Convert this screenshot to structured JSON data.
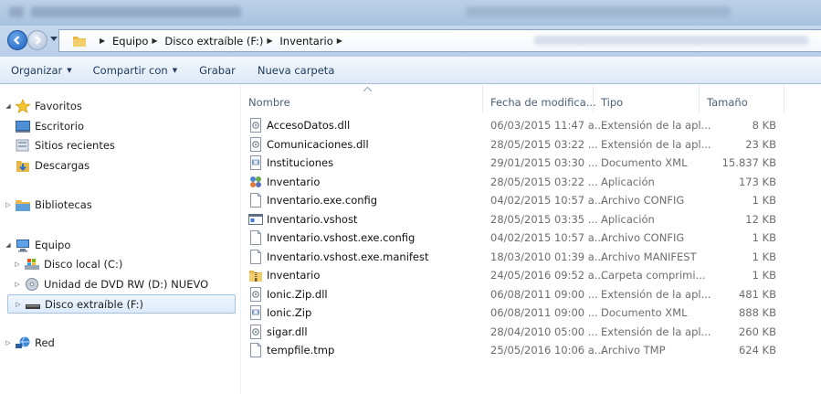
{
  "address": {
    "crumbs": [
      "Equipo",
      "Disco extraíble (F:)",
      "Inventario"
    ]
  },
  "toolbar": {
    "organize": "Organizar",
    "share": "Compartir con",
    "burn": "Grabar",
    "new_folder": "Nueva carpeta"
  },
  "nav": {
    "favorites": "Favoritos",
    "desktop": "Escritorio",
    "recent": "Sitios recientes",
    "downloads": "Descargas",
    "libraries": "Bibliotecas",
    "computer": "Equipo",
    "local_disk": "Disco local (C:)",
    "dvd": "Unidad de DVD RW (D:) NUEVO",
    "removable": "Disco extraíble (F:)",
    "network": "Red"
  },
  "columns": {
    "name": "Nombre",
    "date": "Fecha de modifica...",
    "type": "Tipo",
    "size": "Tamaño"
  },
  "files": [
    {
      "name": "AccesoDatos.dll",
      "date": "06/03/2015 11:47 a...",
      "type": "Extensión de la apl...",
      "size": "8 KB",
      "icon": "dll-icon"
    },
    {
      "name": "Comunicaciones.dll",
      "date": "28/05/2015 03:22 ...",
      "type": "Extensión de la apl...",
      "size": "23 KB",
      "icon": "dll-icon"
    },
    {
      "name": "Instituciones",
      "date": "29/01/2015 03:30 ...",
      "type": "Documento XML",
      "size": "15.837 KB",
      "icon": "xml-icon"
    },
    {
      "name": "Inventario",
      "date": "28/05/2015 03:22 ...",
      "type": "Aplicación",
      "size": "173 KB",
      "icon": "app-icon"
    },
    {
      "name": "Inventario.exe.config",
      "date": "04/02/2015 10:57 a...",
      "type": "Archivo CONFIG",
      "size": "1 KB",
      "icon": "blank-file-icon"
    },
    {
      "name": "Inventario.vshost",
      "date": "28/05/2015 03:35 ...",
      "type": "Aplicación",
      "size": "12 KB",
      "icon": "exe-window-icon"
    },
    {
      "name": "Inventario.vshost.exe.config",
      "date": "04/02/2015 10:57 a...",
      "type": "Archivo CONFIG",
      "size": "1 KB",
      "icon": "blank-file-icon"
    },
    {
      "name": "Inventario.vshost.exe.manifest",
      "date": "18/03/2010 01:39 a...",
      "type": "Archivo MANIFEST",
      "size": "1 KB",
      "icon": "blank-file-icon"
    },
    {
      "name": "Inventario",
      "date": "24/05/2016 09:52 a...",
      "type": "Carpeta comprimi...",
      "size": "1 KB",
      "icon": "zip-folder-icon"
    },
    {
      "name": "Ionic.Zip.dll",
      "date": "06/08/2011 09:00 ...",
      "type": "Extensión de la apl...",
      "size": "481 KB",
      "icon": "dll-icon"
    },
    {
      "name": "Ionic.Zip",
      "date": "06/08/2011 09:00 ...",
      "type": "Documento XML",
      "size": "888 KB",
      "icon": "xml-icon"
    },
    {
      "name": "sigar.dll",
      "date": "28/04/2010 05:00 ...",
      "type": "Extensión de la apl...",
      "size": "260 KB",
      "icon": "dll-icon"
    },
    {
      "name": "tempfile.tmp",
      "date": "25/05/2016 10:06 a...",
      "type": "Archivo TMP",
      "size": "624 KB",
      "icon": "blank-file-icon"
    }
  ]
}
